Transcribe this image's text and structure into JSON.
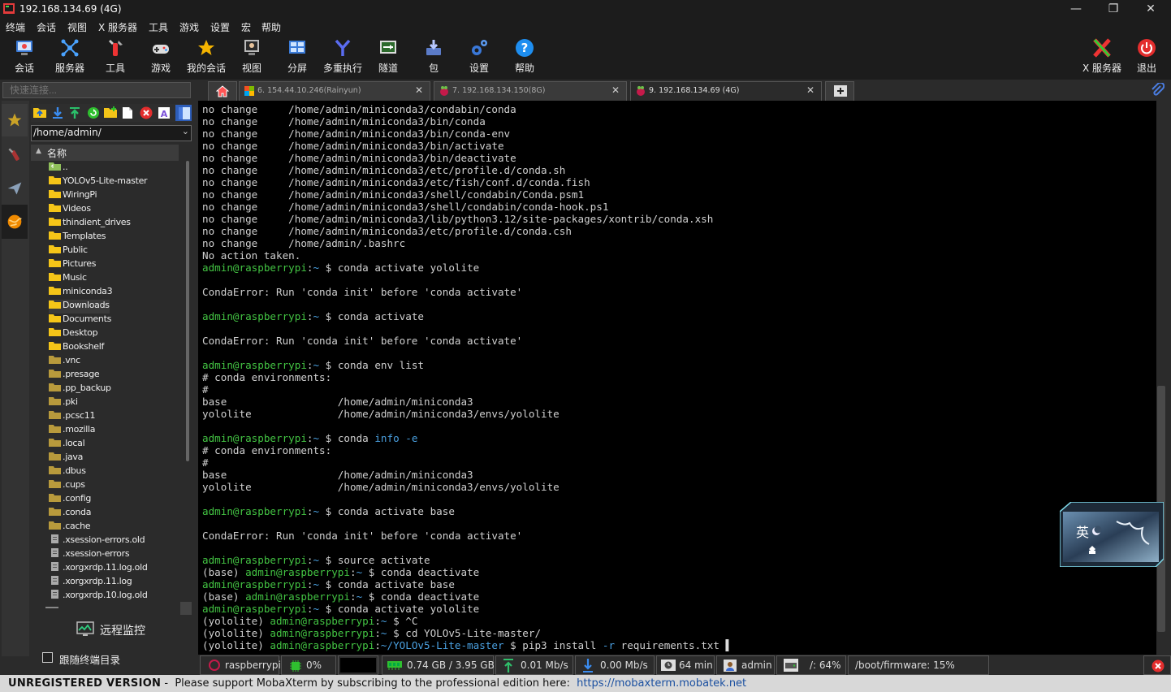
{
  "window": {
    "title": "192.168.134.69 (4G)",
    "min_glyph": "—",
    "max_glyph": "❐",
    "close_glyph": "✕"
  },
  "menu": [
    "终端",
    "会话",
    "视图",
    "X 服务器",
    "工具",
    "游戏",
    "设置",
    "宏",
    "帮助"
  ],
  "toolbar": {
    "items": [
      {
        "label": "会话",
        "icon": "session-icon"
      },
      {
        "label": "服务器",
        "icon": "servers-icon"
      },
      {
        "label": "工具",
        "icon": "tools-icon"
      },
      {
        "label": "游戏",
        "icon": "games-icon"
      },
      {
        "label": "我的会话",
        "icon": "star-icon"
      },
      {
        "label": "视图",
        "icon": "view-icon"
      },
      {
        "label": "分屏",
        "icon": "split-icon"
      },
      {
        "label": "多重执行",
        "icon": "multiexec-icon"
      },
      {
        "label": "隧道",
        "icon": "tunnel-icon"
      },
      {
        "label": "包",
        "icon": "packages-icon"
      },
      {
        "label": "设置",
        "icon": "settings-icon"
      },
      {
        "label": "帮助",
        "icon": "help-icon"
      }
    ],
    "right": [
      {
        "label": "X 服务器",
        "icon": "xserver-icon"
      },
      {
        "label": "退出",
        "icon": "exit-icon"
      }
    ]
  },
  "quick_connect": {
    "placeholder": "快速连接..."
  },
  "tabs": [
    {
      "label": "6. 154.44.10.246(Rainyun)",
      "close": "✕"
    },
    {
      "label": "7. 192.168.134.150(8G)",
      "close": "✕"
    },
    {
      "label": "9. 192.168.134.69 (4G)",
      "close": "✕"
    }
  ],
  "sidebar": {
    "path": "/home/admin/",
    "column_header": "名称",
    "items": [
      "..",
      "YOLOv5-Lite-master",
      "WiringPi",
      "Videos",
      "thindient_drives",
      "Templates",
      "Public",
      "Pictures",
      "Music",
      "miniconda3",
      "Downloads",
      "Documents",
      "Desktop",
      "Bookshelf",
      ".vnc",
      ".presage",
      ".pp_backup",
      ".pki",
      ".pcsc11",
      ".mozilla",
      ".local",
      ".java",
      ".dbus",
      ".cups",
      ".config",
      ".conda",
      ".cache",
      ".xsession-errors.old",
      ".xsession-errors",
      ".xorgxrdp.11.log.old",
      ".xorgxrdp.11.log",
      ".xorgxrdp.10.log.old"
    ],
    "remote_monitor": "远程监控",
    "follow_terminal": "跟随终端目录"
  },
  "terminal": {
    "lines": [
      [
        [
          "c",
          "no change     /home/admin/miniconda3/condabin/conda"
        ]
      ],
      [
        [
          "c",
          "no change     /home/admin/miniconda3/bin/conda"
        ]
      ],
      [
        [
          "c",
          "no change     /home/admin/miniconda3/bin/conda-env"
        ]
      ],
      [
        [
          "c",
          "no change     /home/admin/miniconda3/bin/activate"
        ]
      ],
      [
        [
          "c",
          "no change     /home/admin/miniconda3/bin/deactivate"
        ]
      ],
      [
        [
          "c",
          "no change     /home/admin/miniconda3/etc/profile.d/conda.sh"
        ]
      ],
      [
        [
          "c",
          "no change     /home/admin/miniconda3/etc/fish/conf.d/conda.fish"
        ]
      ],
      [
        [
          "c",
          "no change     /home/admin/miniconda3/shell/condabin/Conda.psm1"
        ]
      ],
      [
        [
          "c",
          "no change     /home/admin/miniconda3/shell/condabin/conda-hook.ps1"
        ]
      ],
      [
        [
          "c",
          "no change     /home/admin/miniconda3/lib/python3.12/site-packages/xontrib/conda.xsh"
        ]
      ],
      [
        [
          "c",
          "no change     /home/admin/miniconda3/etc/profile.d/conda.csh"
        ]
      ],
      [
        [
          "c",
          "no change     /home/admin/.bashrc"
        ]
      ],
      [
        [
          "c",
          "No action taken."
        ]
      ],
      [
        [
          "g",
          "admin@raspberrypi"
        ],
        [
          "c",
          ":"
        ],
        [
          "b",
          "~"
        ],
        [
          "c",
          " $ conda activate yololite"
        ]
      ],
      [
        [
          "c",
          ""
        ]
      ],
      [
        [
          "c",
          "CondaError: Run 'conda init' before 'conda activate'"
        ]
      ],
      [
        [
          "c",
          ""
        ]
      ],
      [
        [
          "g",
          "admin@raspberrypi"
        ],
        [
          "c",
          ":"
        ],
        [
          "b",
          "~"
        ],
        [
          "c",
          " $ conda activate"
        ]
      ],
      [
        [
          "c",
          ""
        ]
      ],
      [
        [
          "c",
          "CondaError: Run 'conda init' before 'conda activate'"
        ]
      ],
      [
        [
          "c",
          ""
        ]
      ],
      [
        [
          "g",
          "admin@raspberrypi"
        ],
        [
          "c",
          ":"
        ],
        [
          "b",
          "~"
        ],
        [
          "c",
          " $ conda env list"
        ]
      ],
      [
        [
          "c",
          "# conda environments:"
        ]
      ],
      [
        [
          "c",
          "#"
        ]
      ],
      [
        [
          "c",
          "base                  /home/admin/miniconda3"
        ]
      ],
      [
        [
          "c",
          "yololite              /home/admin/miniconda3/envs/yololite"
        ]
      ],
      [
        [
          "c",
          ""
        ]
      ],
      [
        [
          "g",
          "admin@raspberrypi"
        ],
        [
          "c",
          ":"
        ],
        [
          "b",
          "~"
        ],
        [
          "c",
          " $ conda "
        ],
        [
          "b",
          "info -e"
        ]
      ],
      [
        [
          "c",
          "# conda environments:"
        ]
      ],
      [
        [
          "c",
          "#"
        ]
      ],
      [
        [
          "c",
          "base                  /home/admin/miniconda3"
        ]
      ],
      [
        [
          "c",
          "yololite              /home/admin/miniconda3/envs/yololite"
        ]
      ],
      [
        [
          "c",
          ""
        ]
      ],
      [
        [
          "g",
          "admin@raspberrypi"
        ],
        [
          "c",
          ":"
        ],
        [
          "b",
          "~"
        ],
        [
          "c",
          " $ conda activate base"
        ]
      ],
      [
        [
          "c",
          ""
        ]
      ],
      [
        [
          "c",
          "CondaError: Run 'conda init' before 'conda activate'"
        ]
      ],
      [
        [
          "c",
          ""
        ]
      ],
      [
        [
          "g",
          "admin@raspberrypi"
        ],
        [
          "c",
          ":"
        ],
        [
          "b",
          "~"
        ],
        [
          "c",
          " $ source activate"
        ]
      ],
      [
        [
          "c",
          "(base) "
        ],
        [
          "g",
          "admin@raspberrypi"
        ],
        [
          "c",
          ":"
        ],
        [
          "b",
          "~"
        ],
        [
          "c",
          " $ conda deactivate"
        ]
      ],
      [
        [
          "g",
          "admin@raspberrypi"
        ],
        [
          "c",
          ":"
        ],
        [
          "b",
          "~"
        ],
        [
          "c",
          " $ conda activate base"
        ]
      ],
      [
        [
          "c",
          "(base) "
        ],
        [
          "g",
          "admin@raspberrypi"
        ],
        [
          "c",
          ":"
        ],
        [
          "b",
          "~"
        ],
        [
          "c",
          " $ conda deactivate"
        ]
      ],
      [
        [
          "g",
          "admin@raspberrypi"
        ],
        [
          "c",
          ":"
        ],
        [
          "b",
          "~"
        ],
        [
          "c",
          " $ conda activate yololite"
        ]
      ],
      [
        [
          "c",
          "(yololite) "
        ],
        [
          "g",
          "admin@raspberrypi"
        ],
        [
          "c",
          ":"
        ],
        [
          "b",
          "~"
        ],
        [
          "c",
          " $ ^C"
        ]
      ],
      [
        [
          "c",
          "(yololite) "
        ],
        [
          "g",
          "admin@raspberrypi"
        ],
        [
          "c",
          ":"
        ],
        [
          "b",
          "~"
        ],
        [
          "c",
          " $ cd YOLOv5-Lite-master/"
        ]
      ],
      [
        [
          "c",
          "(yololite) "
        ],
        [
          "g",
          "admin@raspberrypi"
        ],
        [
          "c",
          ":"
        ],
        [
          "b",
          "~/YOLOv5-Lite-master"
        ],
        [
          "c",
          " $ pip3 install "
        ],
        [
          "b",
          "-r"
        ],
        [
          "c",
          " requirements.txt "
        ]
      ]
    ],
    "cursor": "▌"
  },
  "statusbar": {
    "host": "raspberrypi",
    "cpu": "0%",
    "memory": "0.74 GB / 3.95 GB",
    "upload": "0.01 Mb/s",
    "download": "0.00 Mb/s",
    "uptime": "64 min",
    "user": "admin",
    "disk_root": "/: 64%",
    "disk_boot": "/boot/firmware: 15%"
  },
  "banner": {
    "bold": "UNREGISTERED VERSION",
    "text": " -  Please support MobaXterm by subscribing to the professional edition here:  ",
    "link": "https://mobaxterm.mobatek.net"
  },
  "widget": {
    "text": "英"
  },
  "colors": {
    "prompt_green": "#43c443",
    "path_blue": "#4aa0e0",
    "terminal_bg": "#000000",
    "folder_yellow": "#f5c518"
  }
}
